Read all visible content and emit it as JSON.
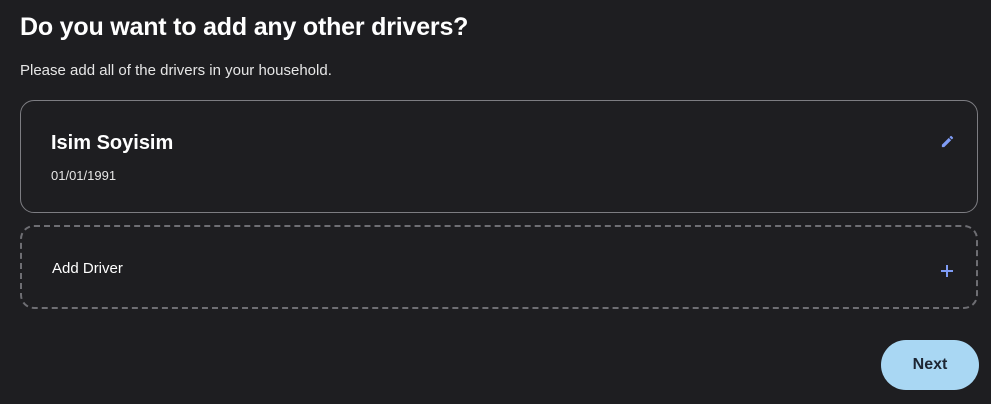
{
  "header": {
    "title": "Do you want to add any other drivers?",
    "subtitle": "Please add all of the drivers in your household."
  },
  "drivers": [
    {
      "name": "Isim Soyisim",
      "date_of_birth": "01/01/1991",
      "action_icon": "pencil-icon"
    }
  ],
  "add_driver": {
    "label": "Add Driver",
    "icon": "plus-icon"
  },
  "footer": {
    "next_label": "Next"
  },
  "colors": {
    "background": "#1e1e21",
    "accent": "#7f9cf5",
    "next_button_bg": "#a9d7f3",
    "next_button_text": "#1d2633",
    "card_border": "#7d7d82"
  }
}
